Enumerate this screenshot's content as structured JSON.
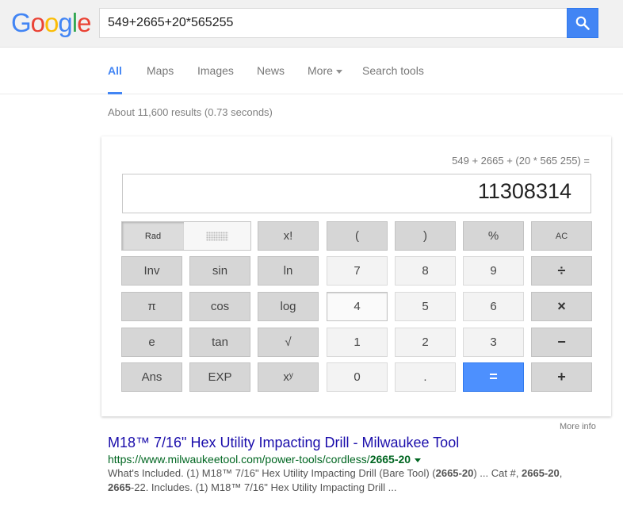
{
  "logo": {
    "text": "Google",
    "letters": [
      {
        "ch": "G",
        "color": "#4285f4"
      },
      {
        "ch": "o",
        "color": "#ea4335"
      },
      {
        "ch": "o",
        "color": "#fbbc05"
      },
      {
        "ch": "g",
        "color": "#4285f4"
      },
      {
        "ch": "l",
        "color": "#34a853"
      },
      {
        "ch": "e",
        "color": "#ea4335"
      }
    ]
  },
  "search": {
    "value": "549+2665+20*565255",
    "button_icon": "search-icon"
  },
  "tabs": [
    {
      "label": "All",
      "active": true
    },
    {
      "label": "Maps"
    },
    {
      "label": "Images"
    },
    {
      "label": "News"
    },
    {
      "label": "More"
    },
    {
      "label": "Search tools"
    }
  ],
  "result_stats": "About 11,600 results (0.73 seconds)",
  "calculator": {
    "expression": "549 + 2665 + (20 * 565 255) =",
    "result": "11308314",
    "rad_label": "Rad",
    "keys": {
      "fact": "x!",
      "lparen": "(",
      "rparen": ")",
      "percent": "%",
      "ac": "AC",
      "inv": "Inv",
      "sin": "sin",
      "ln": "ln",
      "k7": "7",
      "k8": "8",
      "k9": "9",
      "div": "÷",
      "pi": "π",
      "cos": "cos",
      "log": "log",
      "k4": "4",
      "k5": "5",
      "k6": "6",
      "mul": "×",
      "e": "e",
      "tan": "tan",
      "sqrt": "√",
      "k1": "1",
      "k2": "2",
      "k3": "3",
      "sub": "−",
      "ans": "Ans",
      "exp": "EXP",
      "pow": "xʸ",
      "k0": "0",
      "dot": ".",
      "eq": "=",
      "add": "+"
    },
    "more_info": "More info"
  },
  "result": {
    "title": "M18™ 7/16\" Hex Utility Impacting Drill - Milwaukee Tool",
    "url_prefix": "https://www.milwaukeetool.com/power-tools/cordless/",
    "url_bold": "2665-20",
    "snippet": {
      "p1": "What's Included. (1) M18™ 7/16\" Hex Utility Impacting Drill (Bare Tool) (",
      "b1": "2665-20",
      "p2": ") ... Cat #, ",
      "b2": "2665-20",
      "p3": ", ",
      "b3": "2665",
      "p4": "-22. Includes. (1) M18™ 7/16\" Hex Utility Impacting Drill ..."
    }
  }
}
